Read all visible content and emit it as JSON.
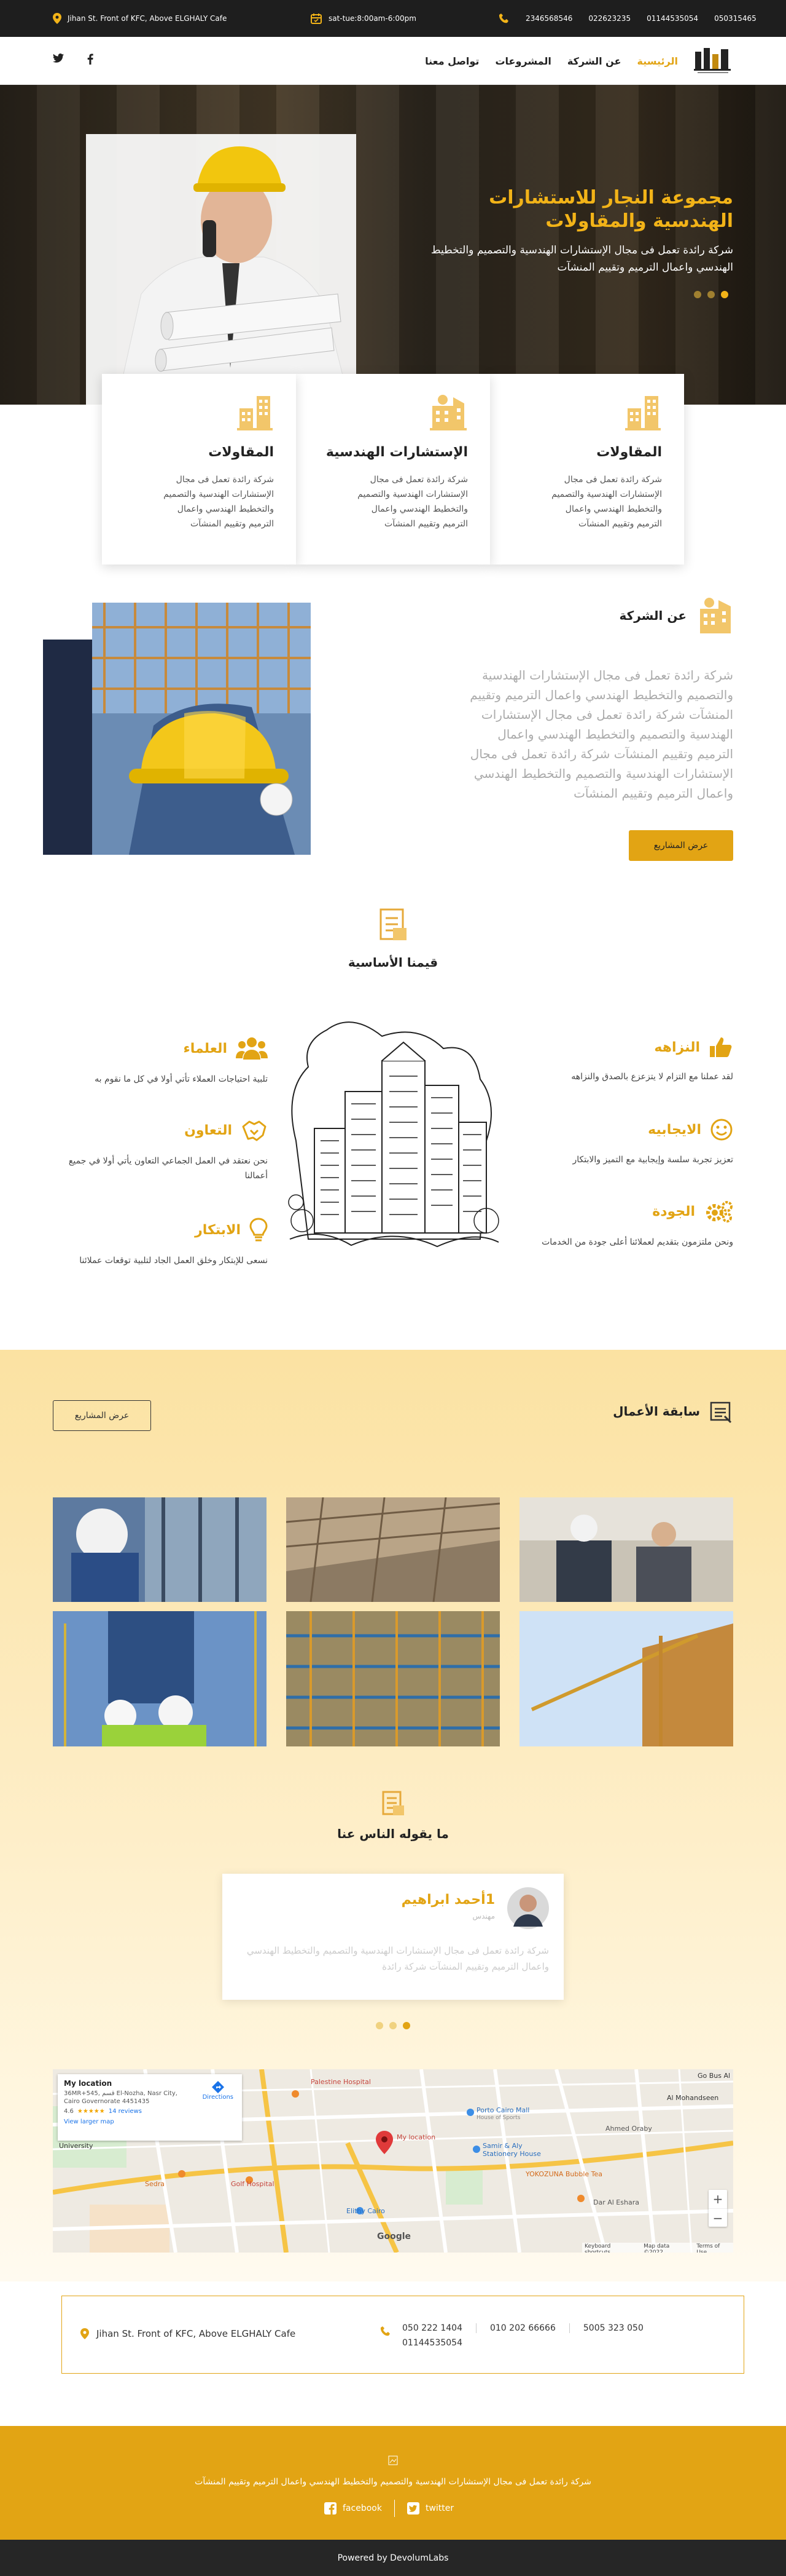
{
  "topbar": {
    "address": "Jihan St. Front of KFC, Above ELGHALY Cafe",
    "hours": "sat-tue:8:00am-6:00pm",
    "phones": [
      "2346568546",
      "022623235",
      "01144535054",
      "050315465"
    ]
  },
  "nav": {
    "items": [
      "الرئيسية",
      "عن الشركة",
      "المشروعات",
      "تواصل معنا"
    ],
    "active_color": "#e2a414"
  },
  "hero": {
    "title": "مجموعة النجار للاستشارات الهندسية والمقاولات",
    "text": "شركة رائدة تعمل فى مجال الإستشارات الهندسية والتصميم والتخطيط الهندسي واعمال الترميم وتقييم المنشآت"
  },
  "cards": [
    {
      "title": "المقاولات",
      "text": "شركة رائدة تعمل فى مجال الإستشارات الهندسية والتصميم والتخطيط الهندسي واعمال الترميم وتقييم المنشآت"
    },
    {
      "title": "الإستشارات الهندسية",
      "text": "شركة رائدة تعمل فى مجال الإستشارات الهندسية والتصميم والتخطيط الهندسي واعمال الترميم وتقييم المنشآت"
    },
    {
      "title": "المقاولات",
      "text": "شركة رائدة تعمل فى مجال الإستشارات الهندسية والتصميم والتخطيط الهندسي واعمال الترميم وتقييم المنشآت"
    }
  ],
  "about": {
    "title": "عن الشركة",
    "text": "شركة رائدة تعمل فى مجال الإستشارات الهندسية والتصميم والتخطيط الهندسي واعمال الترميم وتقييم المنشآت شركة رائدة تعمل فى مجال الإستشارات الهندسية والتصميم والتخطيط الهندسي واعمال الترميم وتقييم المنشآت شركة رائدة تعمل فى مجال الإستشارات الهندسية والتصميم والتخطيط الهندسي واعمال الترميم وتقييم المنشآت",
    "button": "عرض المشاريع"
  },
  "values": {
    "title": "قيمنا الأساسية",
    "right": [
      {
        "title": "النزاهه",
        "text": "لقد عملنا مع التزام لا يتزعزع بالصدق والنزاهه"
      },
      {
        "title": "الايجابيه",
        "text": "تعزيز تجربة سلسة وإيجابية مع التميز والابتكار"
      },
      {
        "title": "الجودة",
        "text": "ونحن ملتزمون بتقديم لعملائنا أعلى جودة من الخدمات"
      }
    ],
    "left": [
      {
        "title": "العلماء",
        "text": "تلبية احتياجات العملاء تأتي أولا في كل ما نقوم به"
      },
      {
        "title": "التعاون",
        "text": "نحن نعتقد في العمل الجماعي التعاون يأتي أولا في جميع أعمالنا"
      },
      {
        "title": "الابتكار",
        "text": "نسعى للإبتكار وخلق العمل الجاد لتلبية توقعات عملائنا"
      }
    ]
  },
  "works": {
    "title": "سابقة الأعمال",
    "button": "عرض المشاريع"
  },
  "testimonials": {
    "title": "ما يقوله الناس عنا",
    "name": "1أحمد ابراهيم",
    "role": "مهندس",
    "text": "شركة رائدة تعمل فى مجال الإستشارات الهندسية والتصميم والتخطيط الهندسي واعمال الترميم وتقييم المنشآت شركة رائدة"
  },
  "map": {
    "box_title": "My location",
    "box_address": "36MR+545, قسم El-Nozha, Nasr City, Cairo Governorate 4451435",
    "rating": "4.6",
    "reviews": "14 reviews",
    "directions": "Directions",
    "larger": "View larger map",
    "labels": {
      "palestine": "Palestine Hospital",
      "porto": "Porto Cairo Mall",
      "porto_sub": "House of Sports",
      "ahmed": "Ahmed Oraby",
      "samir": "Samir & Aly Stationery House",
      "yokozuna": "YOKOZUNA Bubble Tea",
      "ain_shams": "Ain Shams University",
      "sedra": "Sedra",
      "golf": "Golf Hospital",
      "elithy": "Elithy Cairo",
      "mylocation": "My location",
      "dar": "Dar Al Eshara",
      "gobus": "Go Bus Al",
      "google": "Google",
      "shortcuts": "Keyboard shortcuts",
      "mapdata": "Map data ©2022",
      "terms": "Terms of Use",
      "mohandseen": "Al Mohandseen"
    }
  },
  "contact": {
    "address": "Jihan St. Front of KFC, Above ELGHALY Cafe",
    "phones": [
      "050 222 1404",
      "010 202 66666",
      "5005 323 050",
      "01144535054"
    ]
  },
  "footer": {
    "text": "شركة رائدة تعمل فى مجال الإستشارات الهندسية والتصميم والتخطيط الهندسي واعمال الترميم وتقييم المنشآت",
    "facebook": "facebook",
    "twitter": "twitter",
    "powered": "Powered by DevolumLabs"
  }
}
